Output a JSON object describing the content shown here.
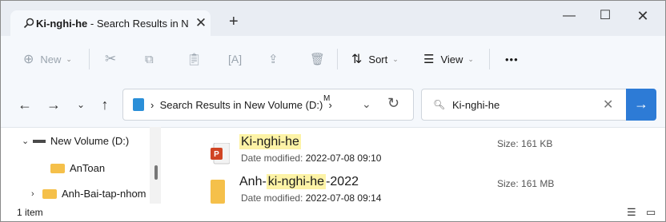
{
  "tab": {
    "title_bold": "Ki-nghi-he",
    "title_rest": " - Search Results in N"
  },
  "toolbar": {
    "new_label": "New",
    "sort_label": "Sort",
    "view_label": "View",
    "more_label": "•••"
  },
  "address": {
    "path": "Search Results in New Volume (D:)",
    "suffix": "M"
  },
  "search": {
    "query": "Ki-nghi-he"
  },
  "nav": {
    "items": [
      {
        "label": "New Volume (D:)"
      },
      {
        "label": "AnToan"
      },
      {
        "label": "Anh-Bai-tap-nhom"
      }
    ]
  },
  "results": [
    {
      "name_parts": [
        "",
        "Ki-nghi-he",
        ""
      ],
      "date_label": "Date modified:",
      "date_value": "2022-07-08 09:10",
      "size_label": "Size:",
      "size_value": "161 KB"
    },
    {
      "name_parts": [
        "Anh-",
        "ki-nghi-he",
        "-2022"
      ],
      "date_label": "Date modified:",
      "date_value": "2022-07-08 09:14",
      "size_label": "Size:",
      "size_value": "161 MB"
    }
  ],
  "status": {
    "count": "1 item"
  },
  "colors": {
    "accent": "#2d7bd6",
    "highlight": "#fdf3a6",
    "folder": "#f5c04a",
    "ppt": "#d04423"
  }
}
